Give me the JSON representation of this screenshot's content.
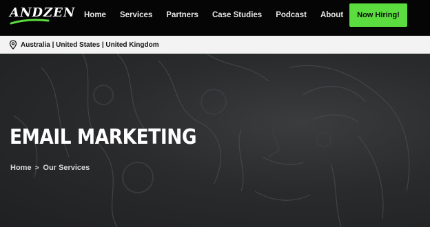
{
  "brand": {
    "logo_text": "ANDZEN",
    "accent": "#5bdc3f"
  },
  "nav": {
    "items": [
      {
        "label": "Home"
      },
      {
        "label": "Services"
      },
      {
        "label": "Partners"
      },
      {
        "label": "Case Studies"
      },
      {
        "label": "Podcast"
      },
      {
        "label": "About"
      }
    ],
    "cta_label": "Now Hiring!"
  },
  "locations": {
    "icon": "map-pin-icon",
    "text": "Australia | United States | United Kingdom"
  },
  "hero": {
    "title": "EMAIL MARKETING",
    "breadcrumb": {
      "home": "Home",
      "separator": ">",
      "current": "Our Services"
    }
  }
}
